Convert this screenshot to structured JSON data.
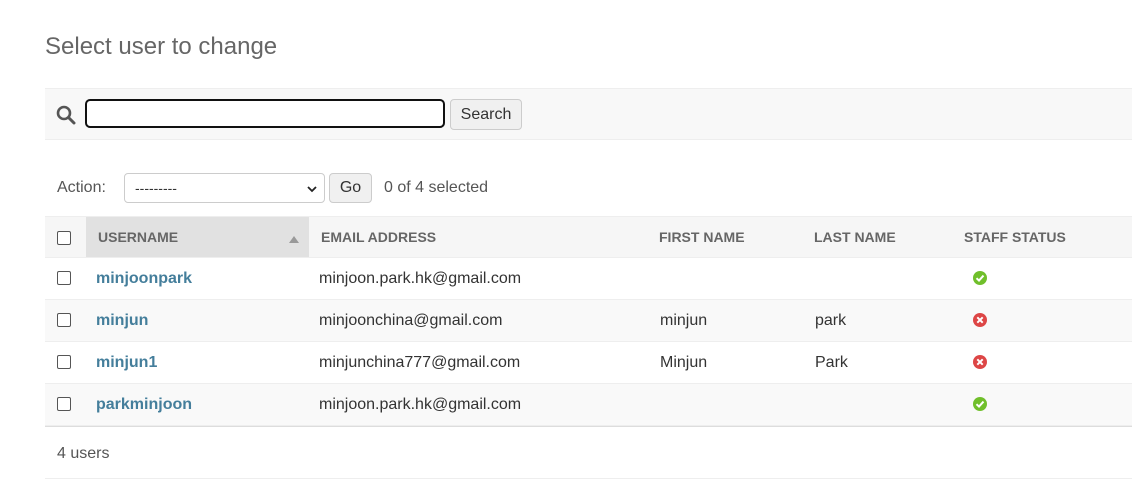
{
  "page": {
    "title": "Select user to change"
  },
  "search": {
    "value": "",
    "placeholder": "",
    "button_label": "Search",
    "icon": "search-icon"
  },
  "actions": {
    "label": "Action:",
    "selected": "---------",
    "go_label": "Go",
    "selection_count": "0 of 4 selected"
  },
  "table": {
    "columns": [
      "USERNAME",
      "EMAIL ADDRESS",
      "FIRST NAME",
      "LAST NAME",
      "STAFF STATUS"
    ],
    "sorted_column": "USERNAME",
    "rows": [
      {
        "username": "minjoonpark",
        "email": "minjoon.park.hk@gmail.com",
        "first_name": "",
        "last_name": "",
        "staff_status": true
      },
      {
        "username": "minjun",
        "email": "minjoonchina@gmail.com",
        "first_name": "minjun",
        "last_name": "park",
        "staff_status": false
      },
      {
        "username": "minjun1",
        "email": "minjunchina777@gmail.com",
        "first_name": "Minjun",
        "last_name": "Park",
        "staff_status": false
      },
      {
        "username": "parkminjoon",
        "email": "minjoon.park.hk@gmail.com",
        "first_name": "",
        "last_name": "",
        "staff_status": true
      }
    ]
  },
  "footer": {
    "count": "4 users"
  },
  "colors": {
    "link": "#447e9b",
    "yes": "#70bf2b",
    "no": "#dd4646"
  }
}
